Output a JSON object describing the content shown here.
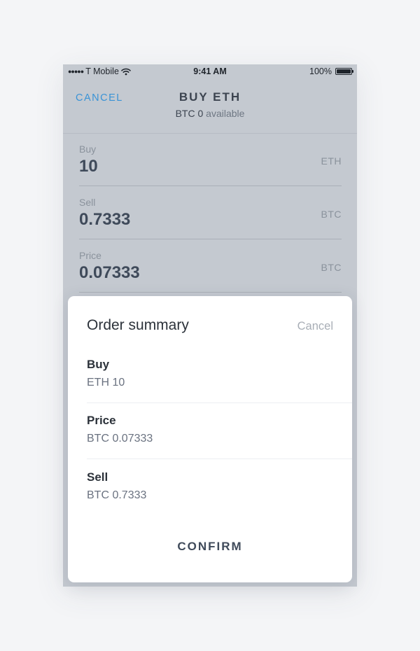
{
  "status_bar": {
    "signal_dots": "●●●●●",
    "carrier": "T Mobile",
    "wifi_icon": "wifi-icon",
    "time": "9:41 AM",
    "battery_percent": "100%",
    "battery_icon": "battery-icon"
  },
  "nav": {
    "cancel": "CANCEL",
    "title": "BUY ETH",
    "subtitle_currency_amount": "BTC 0",
    "subtitle_suffix": "available"
  },
  "form": {
    "buy": {
      "label": "Buy",
      "value": "10",
      "unit": "ETH"
    },
    "sell": {
      "label": "Sell",
      "value": "0.7333",
      "unit": "BTC"
    },
    "price": {
      "label": "Price",
      "value": "0.07333",
      "unit": "BTC"
    }
  },
  "summary": {
    "title": "Order summary",
    "cancel": "Cancel",
    "rows": [
      {
        "label": "Buy",
        "value": "ETH 10"
      },
      {
        "label": "Price",
        "value": "BTC 0.07333"
      },
      {
        "label": "Sell",
        "value": "BTC 0.7333"
      }
    ],
    "confirm": "CONFIRM"
  },
  "colors": {
    "accent": "#3a93d6",
    "overlay": "#c4c9d0",
    "text_dark": "#2c323a",
    "text_muted": "#6a7280"
  }
}
